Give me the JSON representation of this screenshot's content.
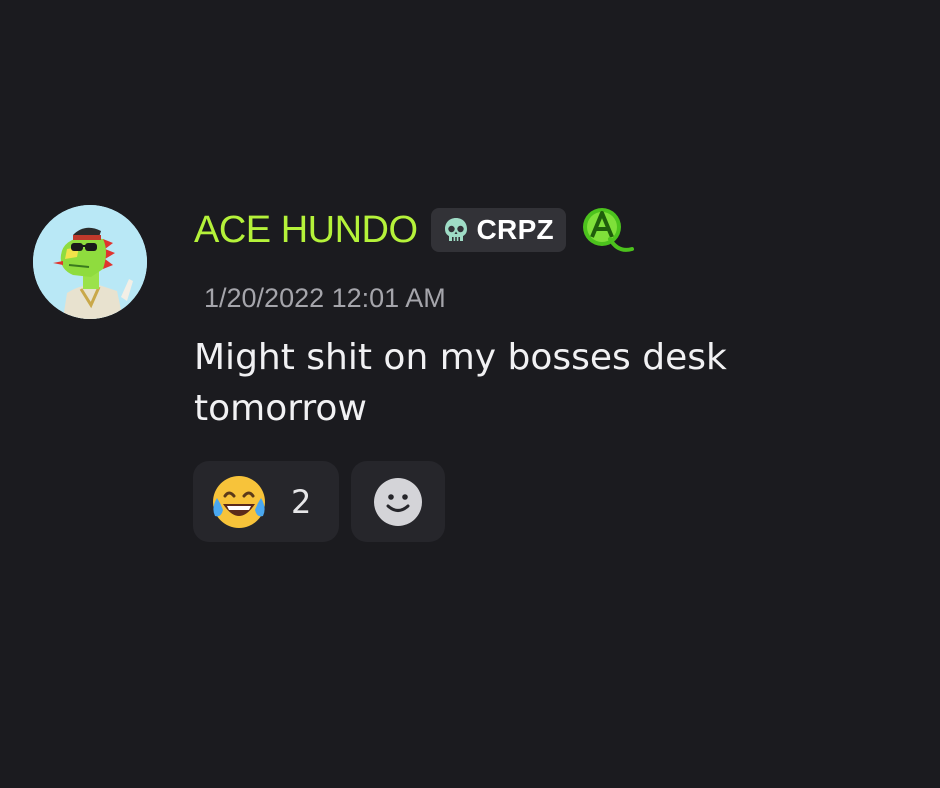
{
  "message": {
    "author": {
      "name": "ACE HUNDO",
      "name_color": "#b5f23a",
      "avatar_icon": "lizard-avatar",
      "tag": {
        "icon": "skull-icon",
        "label": "CRPZ"
      },
      "role_icon": "green-a-badge-icon"
    },
    "timestamp": "1/20/2022 12:01 AM",
    "text": "Might shit on my bosses desk tomorrow"
  },
  "reactions": [
    {
      "emoji": "face-with-tears-of-joy",
      "count": "2"
    },
    {
      "icon": "add-reaction-smiley-icon"
    }
  ]
}
